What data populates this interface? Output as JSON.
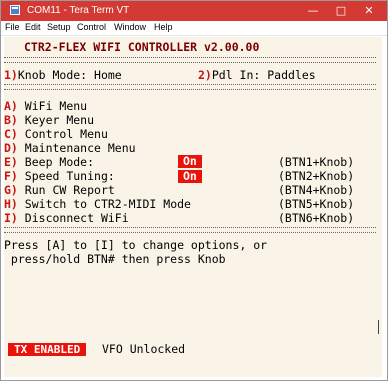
{
  "window": {
    "title": "COM11 - Tera Term VT",
    "controls": [
      "—",
      "□",
      "✕"
    ],
    "title_color": "#d33a33"
  },
  "menu": [
    "File",
    "Edit",
    "Setup",
    "Control",
    "Window",
    "Help"
  ],
  "terminal": {
    "background": "#faf4e8",
    "heading": "CTR2-FLEX WIFI CONTROLLER v2.00.00",
    "top_options": [
      {
        "key": "1)",
        "text": "Knob Mode: Home"
      },
      {
        "key": "2)",
        "text": "Pdl In: Paddles"
      }
    ],
    "menu_items": [
      {
        "key": "A)",
        "label": "WiFi Menu",
        "value": "",
        "hint": ""
      },
      {
        "key": "B)",
        "label": "Keyer Menu",
        "value": "",
        "hint": ""
      },
      {
        "key": "C)",
        "label": "Control Menu",
        "value": "",
        "hint": ""
      },
      {
        "key": "D)",
        "label": "Maintenance Menu",
        "value": "",
        "hint": ""
      },
      {
        "key": "E)",
        "label": "Beep Mode:",
        "value": "On",
        "hint": "(BTN1+Knob)"
      },
      {
        "key": "F)",
        "label": "Speed Tuning:",
        "value": "On",
        "hint": "(BTN2+Knob)"
      },
      {
        "key": "G)",
        "label": "Run CW Report",
        "value": "",
        "hint": "(BTN4+Knob)"
      },
      {
        "key": "H)",
        "label": "Switch to CTR2-MIDI Mode",
        "value": "",
        "hint": "(BTN5+Knob)"
      },
      {
        "key": "I)",
        "label": "Disconnect WiFi",
        "value": "",
        "hint": "(BTN6+Knob)"
      }
    ],
    "instructions": [
      "Press [A] to [I] to change options, or",
      " press/hold BTN# then press Knob"
    ],
    "status": {
      "tx": "TX ENABLED",
      "vfo": "VFO Unlocked"
    },
    "accent": "#e8140b",
    "key_color": "#c41616"
  }
}
